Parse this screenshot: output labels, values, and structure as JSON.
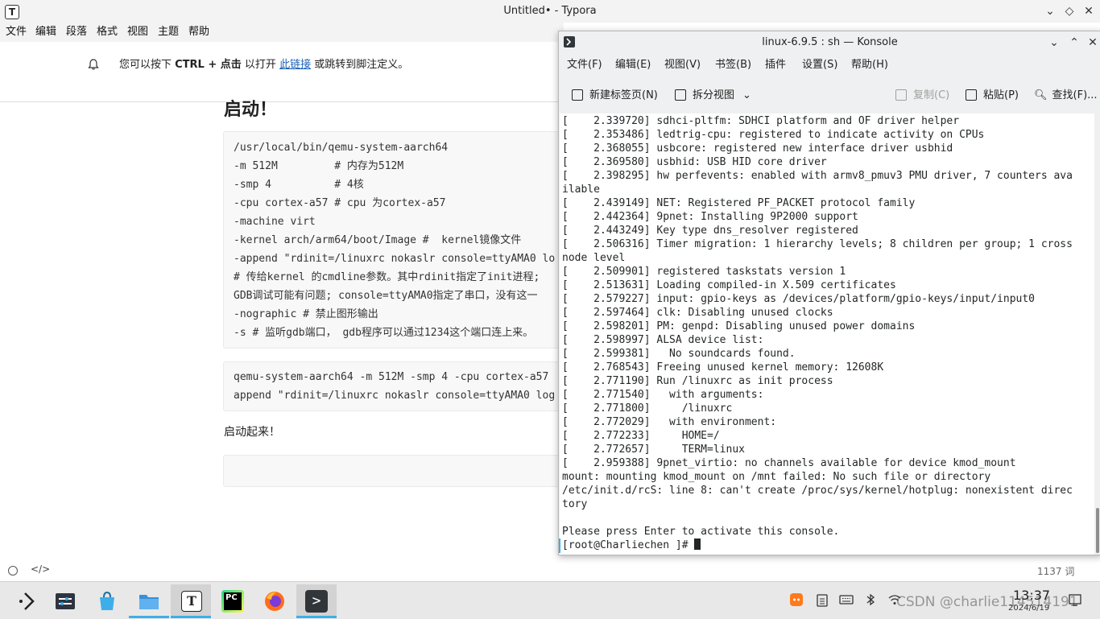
{
  "typora": {
    "title": "Untitled• - Typora",
    "app_icon": "T",
    "menu": [
      "文件",
      "编辑",
      "段落",
      "格式",
      "视图",
      "主题",
      "帮助"
    ],
    "notice": {
      "before": "您可以按下 ",
      "shortcut": "CTRL + 点击",
      "middle": " 以打开 ",
      "link": "此链接",
      "after": " 或跳转到脚注定义。"
    },
    "heading": "启动！",
    "code_block_1": [
      "/usr/local/bin/qemu-system-aarch64",
      "-m 512M         # 内存为512M",
      "-smp 4          # 4核",
      "-cpu cortex-a57 # cpu 为cortex-a57",
      "-machine virt",
      "-kernel arch/arm64/boot/Image #  kernel镜像文件",
      "-append \"rdinit=/linuxrc nokaslr console=ttyAMA0 lo",
      "# 传给kernel 的cmdline参数。其中rdinit指定了init进程;",
      "GDB调试可能有问题; console=ttyAMA0指定了串口，没有这一",
      "-nographic # 禁止图形输出",
      "-s # 监听gdb端口， gdb程序可以通过1234这个端口连上来。"
    ],
    "code_block_2": [
      "qemu-system-aarch64 -m 512M -smp 4 -cpu cortex-a57",
      "append \"rdinit=/linuxrc nokaslr console=ttyAMA0 log"
    ],
    "paragraph": "启动起来！",
    "status": {
      "code_toggle": "</>",
      "word_count": "1137 词"
    }
  },
  "konsole": {
    "title": "linux-6.9.5 : sh — Konsole",
    "menu": [
      "文件(F)",
      "编辑(E)",
      "视图(V)",
      "书签(B)",
      "插件",
      "设置(S)",
      "帮助(H)"
    ],
    "toolbar": {
      "new_tab": "新建标签页(N)",
      "split_view": "拆分视图",
      "copy": "复制(C)",
      "paste": "粘贴(P)",
      "find": "查找(F)..."
    },
    "terminal_lines": [
      "[    2.339720] sdhci-pltfm: SDHCI platform and OF driver helper",
      "[    2.353486] ledtrig-cpu: registered to indicate activity on CPUs",
      "[    2.368055] usbcore: registered new interface driver usbhid",
      "[    2.369580] usbhid: USB HID core driver",
      "[    2.398295] hw perfevents: enabled with armv8_pmuv3 PMU driver, 7 counters ava",
      "ilable",
      "[    2.439149] NET: Registered PF_PACKET protocol family",
      "[    2.442364] 9pnet: Installing 9P2000 support",
      "[    2.443249] Key type dns_resolver registered",
      "[    2.506316] Timer migration: 1 hierarchy levels; 8 children per group; 1 cross",
      "node level",
      "[    2.509901] registered taskstats version 1",
      "[    2.513631] Loading compiled-in X.509 certificates",
      "[    2.579227] input: gpio-keys as /devices/platform/gpio-keys/input/input0",
      "[    2.597464] clk: Disabling unused clocks",
      "[    2.598201] PM: genpd: Disabling unused power domains",
      "[    2.598997] ALSA device list:",
      "[    2.599381]   No soundcards found.",
      "[    2.768543] Freeing unused kernel memory: 12608K",
      "[    2.771190] Run /linuxrc as init process",
      "[    2.771540]   with arguments:",
      "[    2.771800]     /linuxrc",
      "[    2.772029]   with environment:",
      "[    2.772233]     HOME=/",
      "[    2.772657]     TERM=linux",
      "[    2.959388] 9pnet_virtio: no channels available for device kmod_mount",
      "mount: mounting kmod_mount on /mnt failed: No such file or directory",
      "/etc/init.d/rcS: line 8: can't create /proc/sys/kernel/hotplug: nonexistent direc",
      "tory",
      "",
      "Please press Enter to activate this console."
    ],
    "prompt": "[root@Charliechen ]# "
  },
  "taskbar": {
    "apps": [
      {
        "name": "launcher",
        "icon": "launcher-icon"
      },
      {
        "name": "system-settings",
        "icon": "settings-icon"
      },
      {
        "name": "discover",
        "icon": "store-icon"
      },
      {
        "name": "dolphin",
        "icon": "folder-icon"
      },
      {
        "name": "typora",
        "icon": "typora-icon",
        "glyph": "T"
      },
      {
        "name": "pycharm",
        "icon": "pycharm-icon",
        "glyph": "PC"
      },
      {
        "name": "firefox",
        "icon": "firefox-icon"
      },
      {
        "name": "konsole",
        "icon": "konsole-icon",
        "glyph": ">"
      }
    ],
    "clock_time": "13:37",
    "clock_date": "2024/6/19",
    "watermark": "CSDN @charlie114514191"
  },
  "colors": {
    "accent": "#3daee9",
    "link": "#1a5fb4",
    "terminal_bg": "#ffffff",
    "terminal_fg": "#232627"
  }
}
